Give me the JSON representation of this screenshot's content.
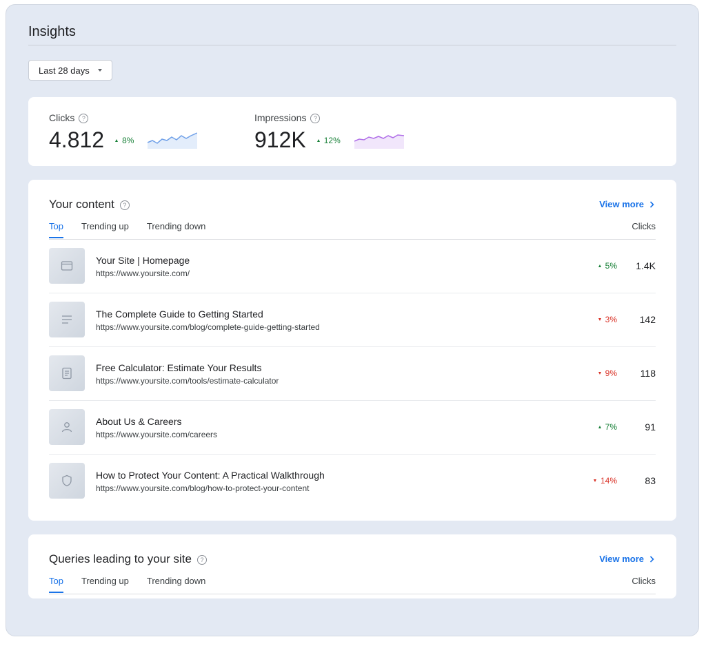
{
  "header": {
    "title": "Insights"
  },
  "date_range": {
    "label": "Last 28 days"
  },
  "stats": [
    {
      "label": "Clicks",
      "value": "4.812",
      "delta": "8%",
      "direction": "up",
      "color": "#6fa0e8",
      "fill": "#e3edfb"
    },
    {
      "label": "Impressions",
      "value": "912K",
      "delta": "12%",
      "direction": "up",
      "color": "#b06ee8",
      "fill": "#f1e6fb"
    }
  ],
  "content": {
    "title": "Your content",
    "view_more": "View more",
    "tabs": [
      "Top",
      "Trending up",
      "Trending down"
    ],
    "column": "Clicks",
    "rows": [
      {
        "title": "Your Site | Homepage",
        "url": "https://www.yoursite.com/",
        "delta": "5%",
        "direction": "up",
        "value": "1.4K",
        "icon": "browser-window-icon"
      },
      {
        "title": "The Complete Guide to Getting Started",
        "url": "https://www.yoursite.com/blog/complete-guide-getting-started",
        "delta": "3%",
        "direction": "down",
        "value": "142",
        "icon": "article-lines-icon"
      },
      {
        "title": "Free Calculator: Estimate Your Results",
        "url": "https://www.yoursite.com/tools/estimate-calculator",
        "delta": "9%",
        "direction": "down",
        "value": "118",
        "icon": "document-icon"
      },
      {
        "title": "About Us & Careers",
        "url": "https://www.yoursite.com/careers",
        "delta": "7%",
        "direction": "up",
        "value": "91",
        "icon": "person-icon"
      },
      {
        "title": "How to Protect Your Content: A Practical Walkthrough",
        "url": "https://www.yoursite.com/blog/how-to-protect-your-content",
        "delta": "14%",
        "direction": "down",
        "value": "83",
        "icon": "shield-icon"
      }
    ]
  },
  "queries": {
    "title": "Queries leading to your site",
    "view_more": "View more",
    "tabs": [
      "Top",
      "Trending up",
      "Trending down"
    ],
    "column": "Clicks"
  }
}
